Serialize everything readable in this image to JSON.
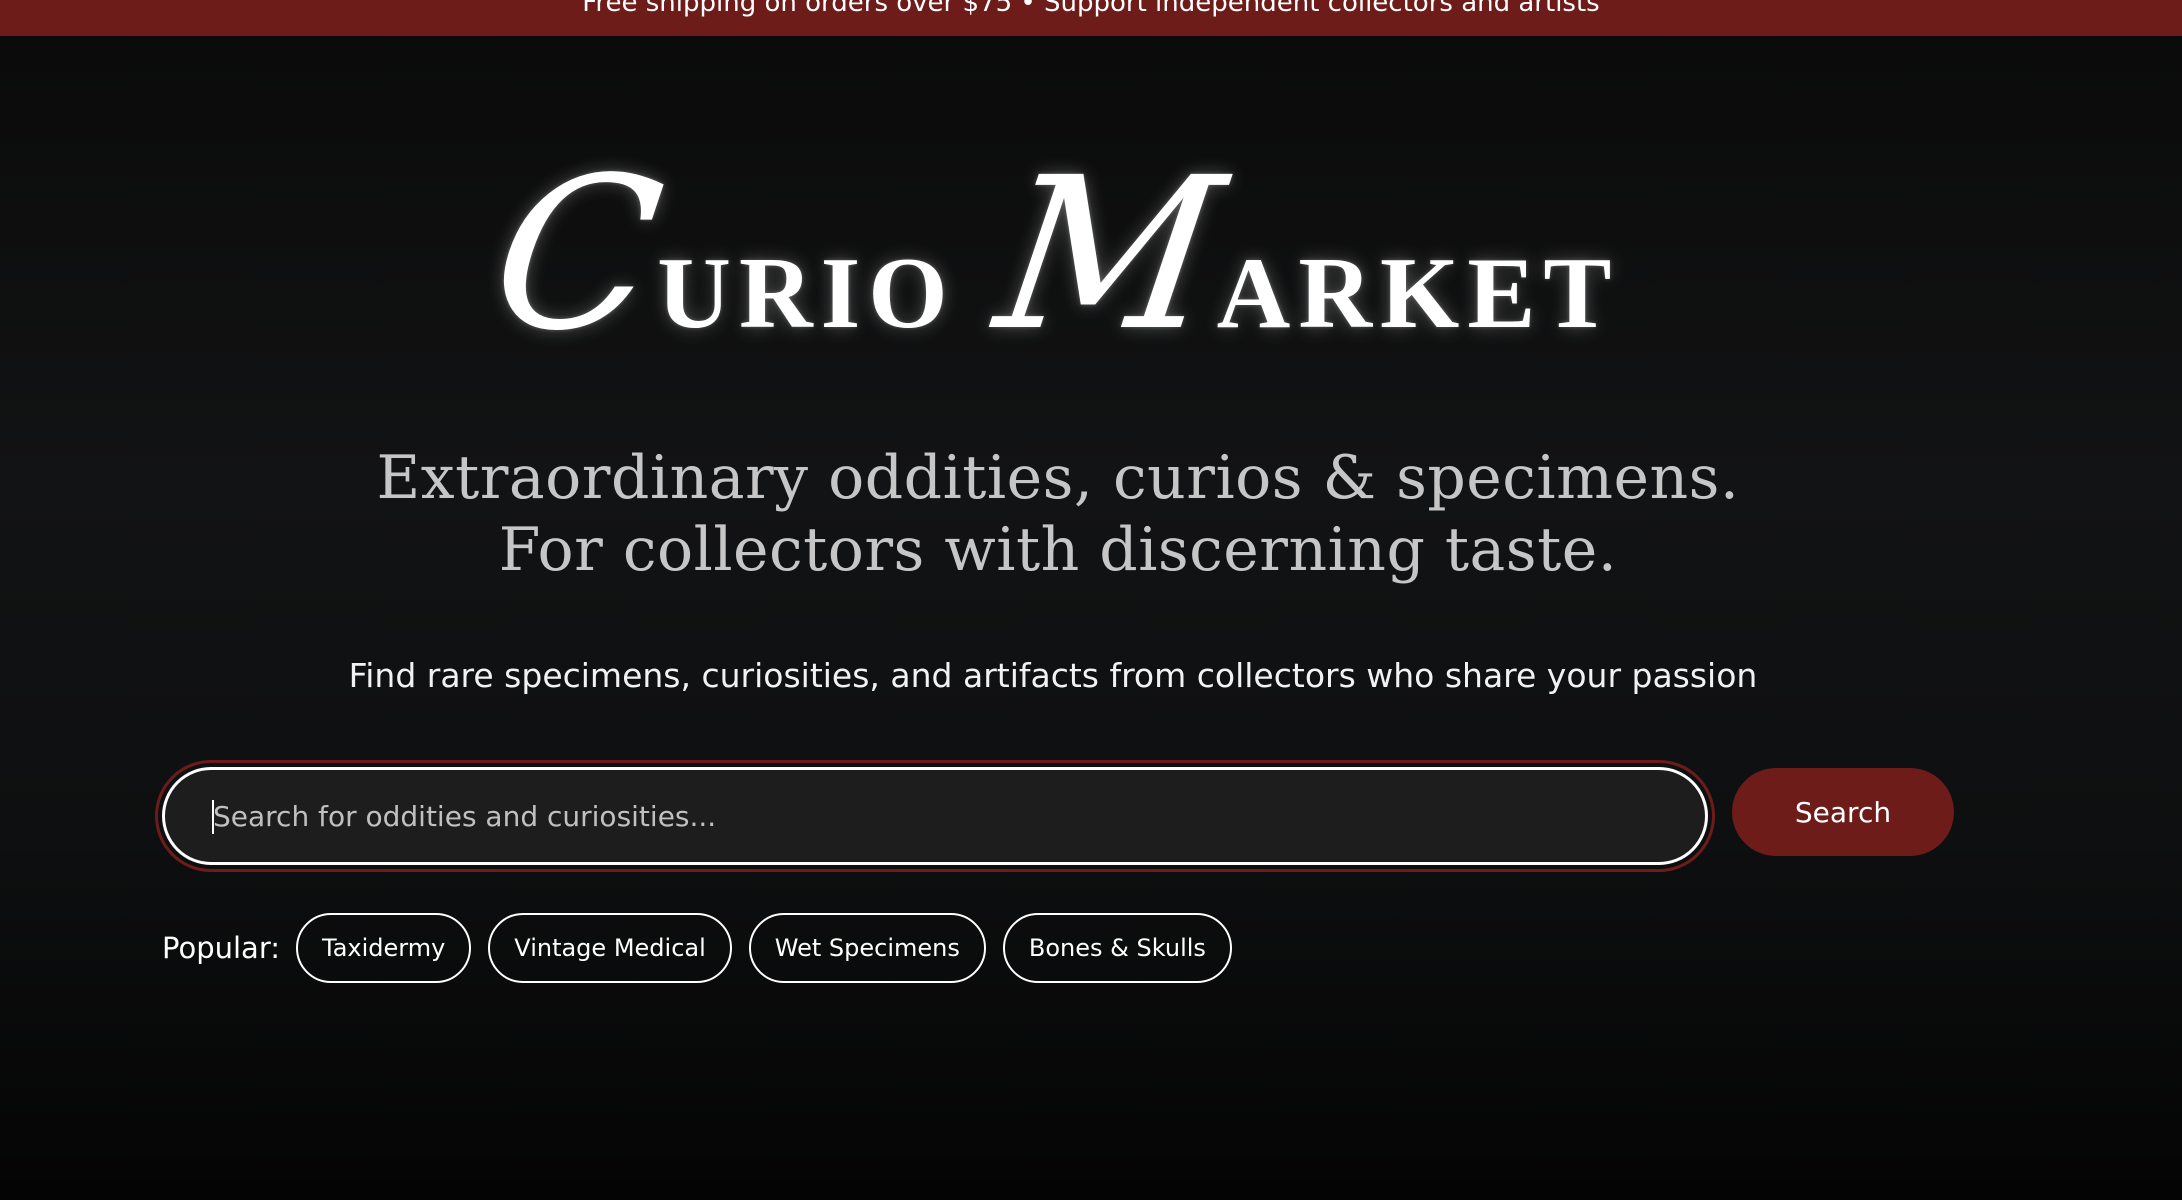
{
  "banner": {
    "text": "Free shipping on orders over $75 • Support independent collectors and artists"
  },
  "logo": {
    "word1_initial": "C",
    "word1_rest": "URIO",
    "word2_initial": "M",
    "word2_rest": "ARKET"
  },
  "hero": {
    "tagline_line1": "Extraordinary oddities, curios & specimens.",
    "tagline_line2": "For collectors with discerning taste.",
    "subtitle": "Find rare specimens, curiosities, and artifacts from collectors who share your passion"
  },
  "search": {
    "placeholder": "Search for oddities and curiosities...",
    "value": "",
    "button_label": "Search"
  },
  "popular": {
    "label": "Popular:",
    "tags": [
      {
        "label": "Taxidermy"
      },
      {
        "label": "Vintage Medical"
      },
      {
        "label": "Wet Specimens"
      },
      {
        "label": "Bones & Skulls"
      }
    ]
  },
  "colors": {
    "accent": "#6e1c1a",
    "background": "#0e0f10",
    "input_background": "#1d1d1d",
    "tagline": "#c6c6c6"
  }
}
